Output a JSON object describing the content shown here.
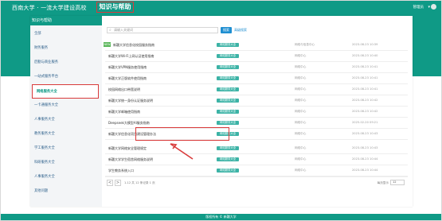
{
  "header": {
    "logo_text": "西南大学 · 一流大学建设高校",
    "site_title": "知识与帮助",
    "user_name": "管理员"
  },
  "sidebar": {
    "title": "知识与帮助",
    "items": [
      {
        "label": "全部",
        "active": false
      },
      {
        "label": "财务服务",
        "active": false
      },
      {
        "label": "后勤与商业服务",
        "active": false
      },
      {
        "label": "一站式服务平台",
        "active": false
      },
      {
        "label": "网络服务大全",
        "active": true
      },
      {
        "label": "一卡通服务大全",
        "active": false
      },
      {
        "label": "人事服务大全",
        "active": false
      },
      {
        "label": "教务服务大全",
        "active": false
      },
      {
        "label": "学工服务大全",
        "active": false
      },
      {
        "label": "科研服务大全",
        "active": false
      },
      {
        "label": "人事服务大全",
        "active": false
      },
      {
        "label": "其他问题",
        "active": false
      }
    ]
  },
  "search": {
    "placeholder": "请输入关键词",
    "button": "搜索",
    "advanced": "高级搜索"
  },
  "rows": [
    {
      "title": "新疆大学信息化校园服务指南",
      "badge": "网络服务大全",
      "meta": "网络与信息中心",
      "date": "2023-08-23 10:39",
      "new": true
    },
    {
      "title": "新疆大学Wi-Fi上网认证使用指南",
      "badge": "网络服务大全",
      "meta": "网络中心",
      "date": "2023-08-23 10:40",
      "new": false
    },
    {
      "title": "新疆大学VPN服务使用指南",
      "badge": "网络服务大全",
      "meta": "网络中心",
      "date": "2023-08-23 10:41",
      "new": false
    },
    {
      "title": "新疆大学正版软件使用指南",
      "badge": "网络服务大全",
      "meta": "网络中心",
      "date": "2023-08-23 10:41",
      "new": false
    },
    {
      "title": "校园网络出口带宽说明",
      "badge": "网络服务大全",
      "meta": "网络中心",
      "date": "2023-08-23 10:41",
      "new": false
    },
    {
      "title": "新疆大学统一身份认证服务说明",
      "badge": "网络服务大全",
      "meta": "网络中心",
      "date": "2023-08-23 10:42",
      "new": false
    },
    {
      "title": "新疆大学邮箱使用指南",
      "badge": "网络服务大全",
      "meta": "网络中心",
      "date": "2023-08-23 10:42",
      "new": false
    },
    {
      "title": "Deepseek大模型AI服务指南",
      "badge": "网络服务大全",
      "meta": "网络中心",
      "date": "2025-02-20 09:21",
      "new": false
    },
    {
      "title": "新疆大学信息化项目建设管理办法",
      "badge": "网络服务大全",
      "meta": "网络中心",
      "date": "2023-08-23 10:43",
      "new": false
    },
    {
      "title": "新疆大学网络安全管理规定",
      "badge": "网络服务大全",
      "meta": "网络中心",
      "date": "2023-08-23 10:43",
      "new": false
    },
    {
      "title": "新疆大学学生宿舍网络服务说明",
      "badge": "网络服务大全",
      "meta": "网络中心",
      "date": "2023-08-23 10:44",
      "new": false
    },
    {
      "title": "学生教务系统入口",
      "badge": "网络服务大全",
      "meta": "网络中心",
      "date": "2023-08-23 10:44",
      "new": false
    }
  ],
  "pager": {
    "prev": "<",
    "next": ">",
    "info": "1-12 共 12 条记录 1 页",
    "size_label": "每页显示",
    "size": "12"
  },
  "footer": {
    "text": "版权所有 © 新疆大学"
  }
}
